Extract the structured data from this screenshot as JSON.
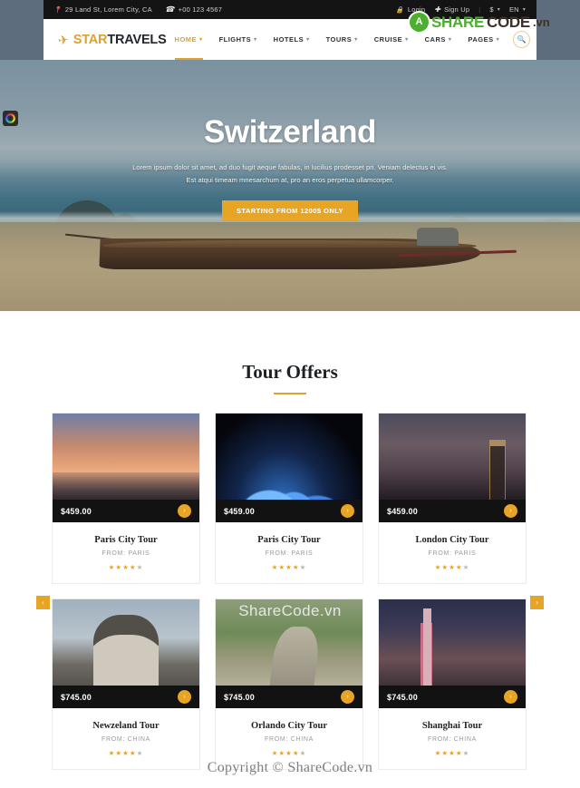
{
  "topbar": {
    "address": "29 Land St, Lorem City, CA",
    "phone": "+00 123 4567",
    "login": "Login",
    "signup": "Sign Up",
    "separator": "|",
    "currency": "$",
    "language": "EN"
  },
  "brand": {
    "name_first": "STAR",
    "name_second": "TRAVELS"
  },
  "nav": {
    "items": [
      {
        "label": "HOME",
        "active": true
      },
      {
        "label": "FLIGHTS",
        "active": false
      },
      {
        "label": "HOTELS",
        "active": false
      },
      {
        "label": "TOURS",
        "active": false
      },
      {
        "label": "CRUISE",
        "active": false
      },
      {
        "label": "CARS",
        "active": false
      },
      {
        "label": "PAGES",
        "active": false
      }
    ]
  },
  "hero": {
    "title": "Switzerland",
    "subtitle": "Lorem ipsum dolor sit amet, ad duo fugit aeque fabulas, in lucilius prodesset pri. Veniam delectus ei vis. Est atqui timeam mnesarchum at, pro an eros perpetua ullamcorper.",
    "cta": "STARTING FROM 1200$ ONLY"
  },
  "offers": {
    "title": "Tour Offers",
    "prev_label": "‹",
    "next_label": "›",
    "cards": [
      {
        "price": "$459.00",
        "title": "Paris City Tour",
        "from": "FROM: PARIS",
        "rating": 4,
        "photo": "paris"
      },
      {
        "price": "$459.00",
        "title": "Paris City Tour",
        "from": "FROM: PARIS",
        "rating": 4,
        "photo": "sydney"
      },
      {
        "price": "$459.00",
        "title": "London City Tour",
        "from": "FROM: PARIS",
        "rating": 4,
        "photo": "london"
      },
      {
        "price": "$745.00",
        "title": "Newzeland Tour",
        "from": "FROM: CHINA",
        "rating": 4,
        "photo": "arch"
      },
      {
        "price": "$745.00",
        "title": "Orlando City Tour",
        "from": "FROM: CHINA",
        "rating": 4,
        "photo": "road"
      },
      {
        "price": "$745.00",
        "title": "Shanghai Tour",
        "from": "FROM: CHINA",
        "rating": 4,
        "photo": "shanghai"
      }
    ]
  },
  "watermarks": {
    "header_share": "SHARE",
    "header_code": "CODE",
    "header_vn": ".vn",
    "header_mark": "A",
    "middle": "ShareCode.vn",
    "copyright": "Copyright © ShareCode.vn"
  },
  "colors": {
    "accent": "#dfa12c",
    "cta": "#e8a525",
    "dark": "#121212",
    "brand_dark": "#23272b",
    "watermark_green": "#4caf2f"
  }
}
